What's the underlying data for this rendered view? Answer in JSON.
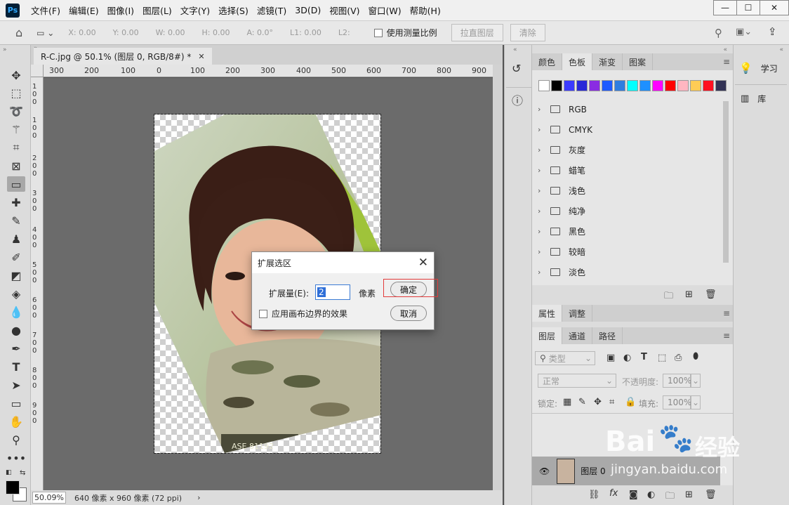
{
  "app": {
    "logo": "Ps",
    "menus": [
      "文件(F)",
      "编辑(E)",
      "图像(I)",
      "图层(L)",
      "文字(Y)",
      "选择(S)",
      "滤镜(T)",
      "3D(D)",
      "视图(V)",
      "窗口(W)",
      "帮助(H)"
    ]
  },
  "options": {
    "x": "X: 0.00",
    "y": "Y: 0.00",
    "w": "W: 0.00",
    "h": "H: 0.00",
    "a": "A: 0.0°",
    "l1": "L1: 0.00",
    "l2": "L2:",
    "use_scale": "使用测量比例",
    "straighten": "拉直图层",
    "clear": "清除"
  },
  "document": {
    "tab_title": "R-C.jpg @ 50.1% (图层 0, RGB/8#) *",
    "ruler_top": [
      "300",
      "200",
      "100",
      "0",
      "100",
      "200",
      "300",
      "400",
      "500",
      "600",
      "700",
      "800",
      "900"
    ],
    "ruler_left": [
      "1\n0\n0",
      "1\n0\n0",
      "2\n0\n0",
      "3\n0\n0",
      "4\n0\n0",
      "5\n0\n0",
      "6\n0\n0",
      "7\n0\n0",
      "8\n0\n0",
      "9\n0\n0"
    ],
    "zoom": "50.09%",
    "size_info": "640 像素 x 960 像素 (72 ppi)",
    "patch_text": "ASE 81192"
  },
  "dialog": {
    "title": "扩展选区",
    "amount_label": "扩展量(E):",
    "amount_value": "2",
    "unit": "像素",
    "canvas_effect_label": "应用画布边界的效果",
    "ok": "确定",
    "cancel": "取消"
  },
  "swatches_panel": {
    "tabs": [
      "颜色",
      "色板",
      "渐变",
      "图案"
    ],
    "colors": [
      "#ffffff",
      "#000000",
      "#3a3aff",
      "#2828d8",
      "#8a2be2",
      "#1e5bff",
      "#2f7de0",
      "#00ffff",
      "#1e90ff",
      "#ff00ff",
      "#ff0000",
      "#ffb6c1",
      "#ffcc55",
      "#ff1020",
      "#333355"
    ],
    "groups": [
      "RGB",
      "CMYK",
      "灰度",
      "蜡笔",
      "浅色",
      "纯净",
      "黑色",
      "较暗",
      "淡色"
    ]
  },
  "props_panel": {
    "tabs": [
      "属性",
      "调整"
    ]
  },
  "layers_panel": {
    "tabs": [
      "图层",
      "通道",
      "路径"
    ],
    "filter_placeholder": "类型",
    "blend_mode": "正常",
    "opacity_label": "不透明度:",
    "opacity_value": "100%",
    "lock_label": "锁定:",
    "fill_label": "填充:",
    "fill_value": "100%",
    "layer_name": "图层 0"
  },
  "learn_panel": {
    "learn": "学习",
    "library": "库"
  },
  "watermark": {
    "brand": "Bai",
    "brand_cn": "经验",
    "url": "jingyan.baidu.com"
  }
}
